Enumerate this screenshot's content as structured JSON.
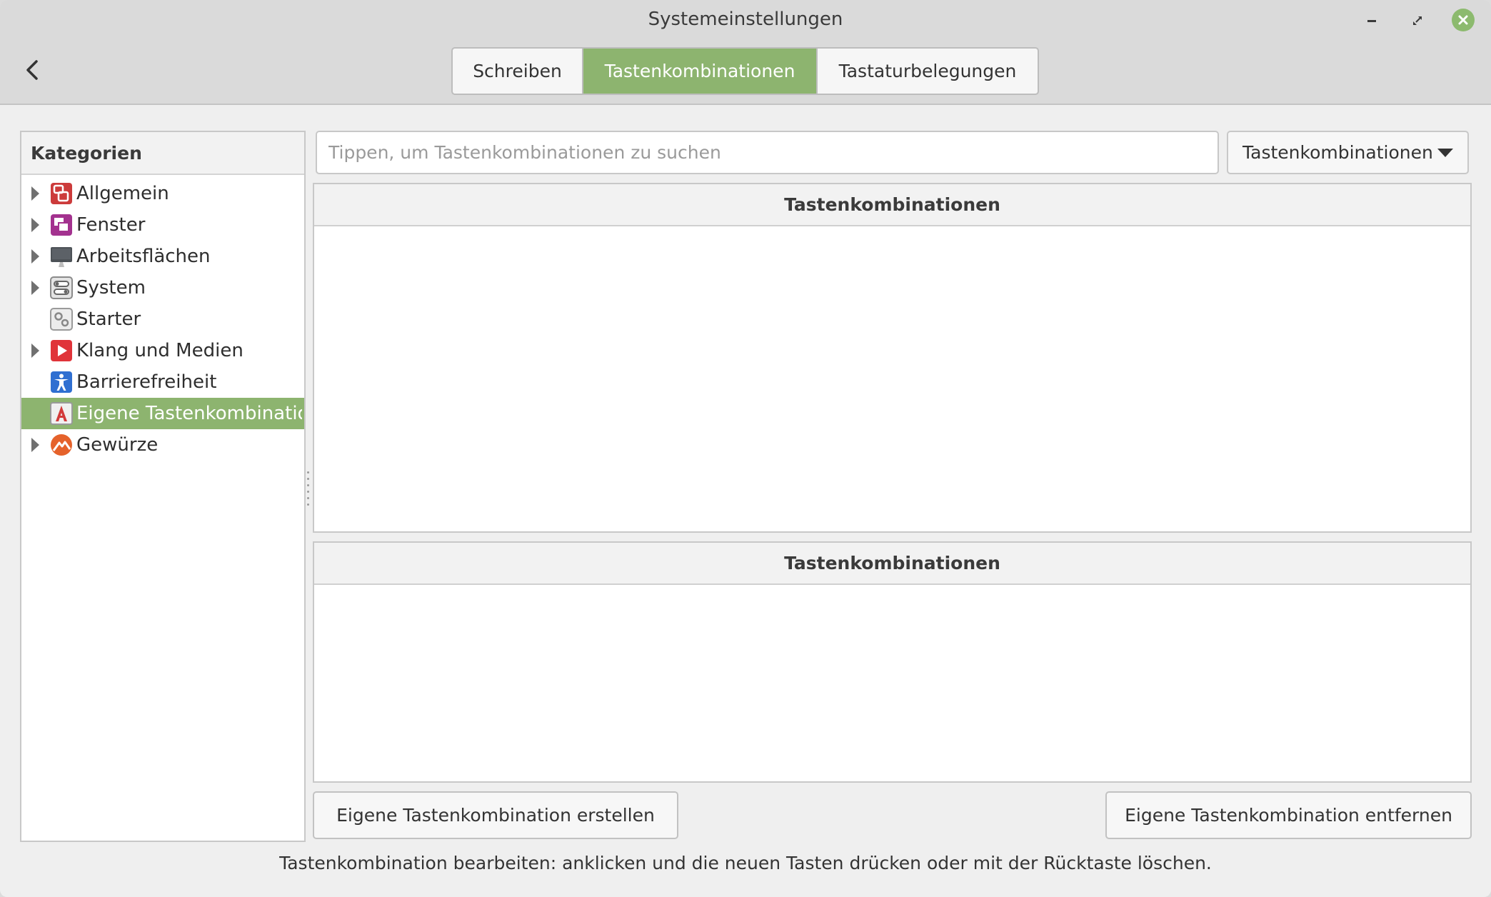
{
  "window": {
    "title": "Systemeinstellungen"
  },
  "tabs": [
    {
      "label": "Schreiben",
      "active": false
    },
    {
      "label": "Tastenkombinationen",
      "active": true
    },
    {
      "label": "Tastaturbelegungen",
      "active": false
    }
  ],
  "sidebar": {
    "header": "Kategorien",
    "items": [
      {
        "label": "Allgemein",
        "icon": "general-settings-icon",
        "expandable": true,
        "selected": false
      },
      {
        "label": "Fenster",
        "icon": "window-icon",
        "expandable": true,
        "selected": false
      },
      {
        "label": "Arbeitsflächen",
        "icon": "workspace-icon",
        "expandable": true,
        "selected": false
      },
      {
        "label": "System",
        "icon": "system-icon",
        "expandable": true,
        "selected": false
      },
      {
        "label": "Starter",
        "icon": "launcher-icon",
        "expandable": false,
        "selected": false
      },
      {
        "label": "Klang und Medien",
        "icon": "media-icon",
        "expandable": true,
        "selected": false
      },
      {
        "label": "Barrierefreiheit",
        "icon": "accessibility-icon",
        "expandable": false,
        "selected": false
      },
      {
        "label": "Eigene Tastenkombinationen",
        "icon": "custom-shortcut-icon",
        "expandable": false,
        "selected": true
      },
      {
        "label": "Gewürze",
        "icon": "spices-icon",
        "expandable": true,
        "selected": false
      }
    ]
  },
  "search": {
    "placeholder": "Tippen, um Tastenkombinationen zu suchen",
    "value": ""
  },
  "filter_dropdown": {
    "selected": "Tastenkombinationen"
  },
  "panels": {
    "top_header": "Tastenkombinationen",
    "bottom_header": "Tastenkombinationen"
  },
  "buttons": {
    "add_label": "Eigene Tastenkombination erstellen",
    "remove_label": "Eigene Tastenkombination entfernen"
  },
  "hint_text": "Tastenkombination bearbeiten: anklicken und die neuen Tasten drücken oder mit der Rücktaste löschen.",
  "colors": {
    "accent": "#8db46f",
    "close_button": "#8cba6e"
  }
}
